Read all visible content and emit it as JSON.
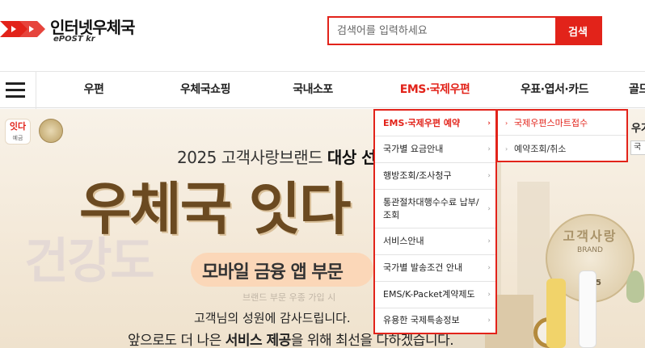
{
  "header": {
    "logo_title": "인터넷우체국",
    "logo_sub": "ePOST kr",
    "search_placeholder": "검색어를 입력하세요",
    "search_button": "검색"
  },
  "nav": {
    "items": [
      "우편",
      "우체국쇼핑",
      "국내소포",
      "EMS·국제우편",
      "우표·엽서·카드",
      "골드"
    ],
    "active_index": 3
  },
  "banner": {
    "ida_logo": "잇다",
    "ida_sub": "예금",
    "award_prefix": "2025 고객사랑브랜드",
    "award_bold": "대상 선",
    "big_title": "우체국 잇다",
    "ghost_text": "건강도",
    "pill_text": "모바일 금융 앱 부문",
    "faded_line": "브랜드 부문 우종 가입 시",
    "thanks_line": "고객님의 성원에 감사드립니다.",
    "promise_prefix": "앞으로도 더 나은 ",
    "promise_bold": "서비스 제공",
    "promise_suffix": "을 위해 최선을 다하겠습니다.",
    "medal_title": "고객사랑",
    "medal_brand": "BRAND",
    "medal_year": "2025"
  },
  "dropdown": {
    "items": [
      "EMS·국제우편 예약",
      "국가별 요금안내",
      "행방조회/조사청구",
      "통관절차대행수수료 납부/조회",
      "서비스안내",
      "국가별 발송조건 안내",
      "EMS/K-Packet계약제도",
      "유용한 국제특송정보"
    ],
    "active_index": 0,
    "sub_items": [
      "국제우편스마트접수",
      "예약조회/취소"
    ]
  },
  "side": {
    "label": "우겨",
    "input_value": "국"
  },
  "colors": {
    "brand_red": "#e2231a",
    "banner_bg": "#f3e8d7",
    "title_brown": "#6b4a21"
  }
}
